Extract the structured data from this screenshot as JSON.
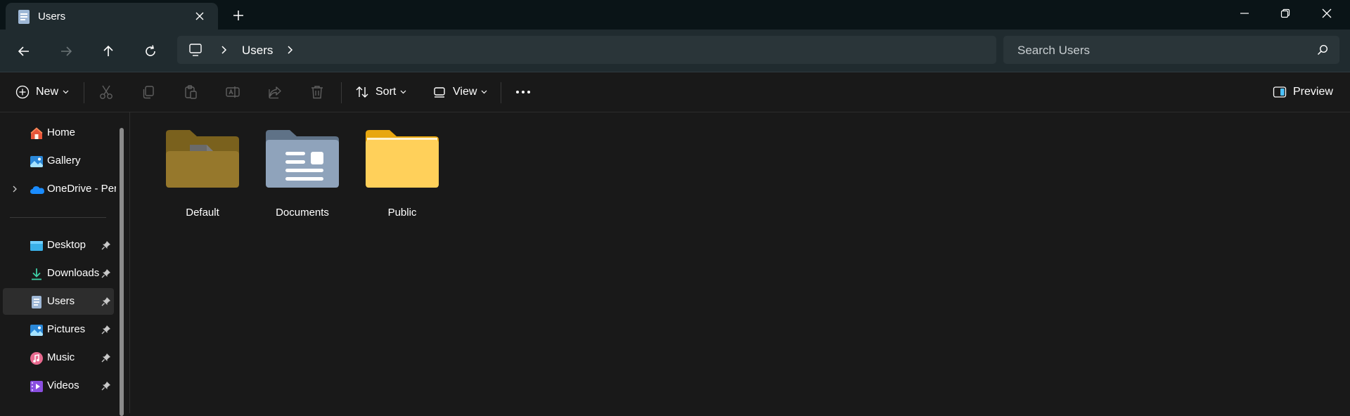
{
  "window": {
    "tab_title": "Users",
    "tab_icon": "users-folder-icon"
  },
  "navigation": {
    "path": [
      "Users"
    ],
    "search_placeholder": "Search Users"
  },
  "commands": {
    "new_label": "New",
    "sort_label": "Sort",
    "view_label": "View",
    "preview_label": "Preview"
  },
  "sidebar": {
    "items": [
      {
        "label": "Home",
        "icon": "home-icon"
      },
      {
        "label": "Gallery",
        "icon": "gallery-icon"
      },
      {
        "label": "OneDrive - Personal",
        "icon": "onedrive-icon"
      }
    ],
    "pinned": [
      {
        "label": "Desktop",
        "icon": "desktop-icon"
      },
      {
        "label": "Downloads",
        "icon": "downloads-icon"
      },
      {
        "label": "Users",
        "icon": "users-icon"
      },
      {
        "label": "Pictures",
        "icon": "pictures-icon"
      },
      {
        "label": "Music",
        "icon": "music-icon"
      },
      {
        "label": "Videos",
        "icon": "videos-icon"
      }
    ]
  },
  "content": {
    "items": [
      {
        "label": "Default",
        "icon": "default-folder-icon"
      },
      {
        "label": "Documents",
        "icon": "documents-folder-icon"
      },
      {
        "label": "Public",
        "icon": "public-folder-icon"
      }
    ]
  },
  "colors": {
    "background": "#191919",
    "titlebar": "#0a1417",
    "navbar": "#202b2f",
    "accent": "#4cc2ff",
    "folder_yellow": "#ffc83d"
  }
}
